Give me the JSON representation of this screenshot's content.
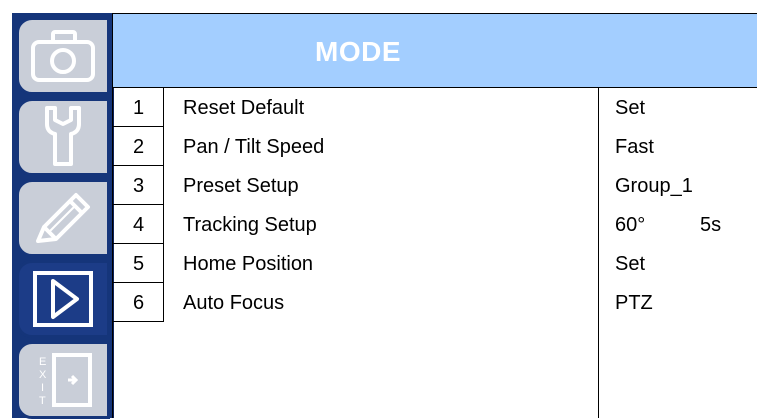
{
  "header": {
    "title": "MODE"
  },
  "sidebar": {
    "tabs": [
      {
        "icon": "camera-icon",
        "active": false
      },
      {
        "icon": "wrench-icon",
        "active": false
      },
      {
        "icon": "pencil-icon",
        "active": false
      },
      {
        "icon": "play-icon",
        "active": true
      },
      {
        "icon": "exit-icon",
        "active": false,
        "text": "EXIT"
      }
    ]
  },
  "menu": {
    "rows": [
      {
        "num": "1",
        "label": "Reset Default",
        "value": "Set"
      },
      {
        "num": "2",
        "label": "Pan / Tilt Speed",
        "value": "Fast"
      },
      {
        "num": "3",
        "label": "Preset Setup",
        "value": "Group_1"
      },
      {
        "num": "4",
        "label": "Tracking Setup",
        "value": "60°",
        "value2": "5s"
      },
      {
        "num": "5",
        "label": "Home Position",
        "value": "Set"
      },
      {
        "num": "6",
        "label": "Auto Focus",
        "value": "PTZ"
      }
    ]
  },
  "colors": {
    "header_bg": "#a3ceff",
    "sidebar_bg": "#15357a",
    "tab_inactive": "#c9ced8",
    "tab_active": "#1c3c87"
  }
}
